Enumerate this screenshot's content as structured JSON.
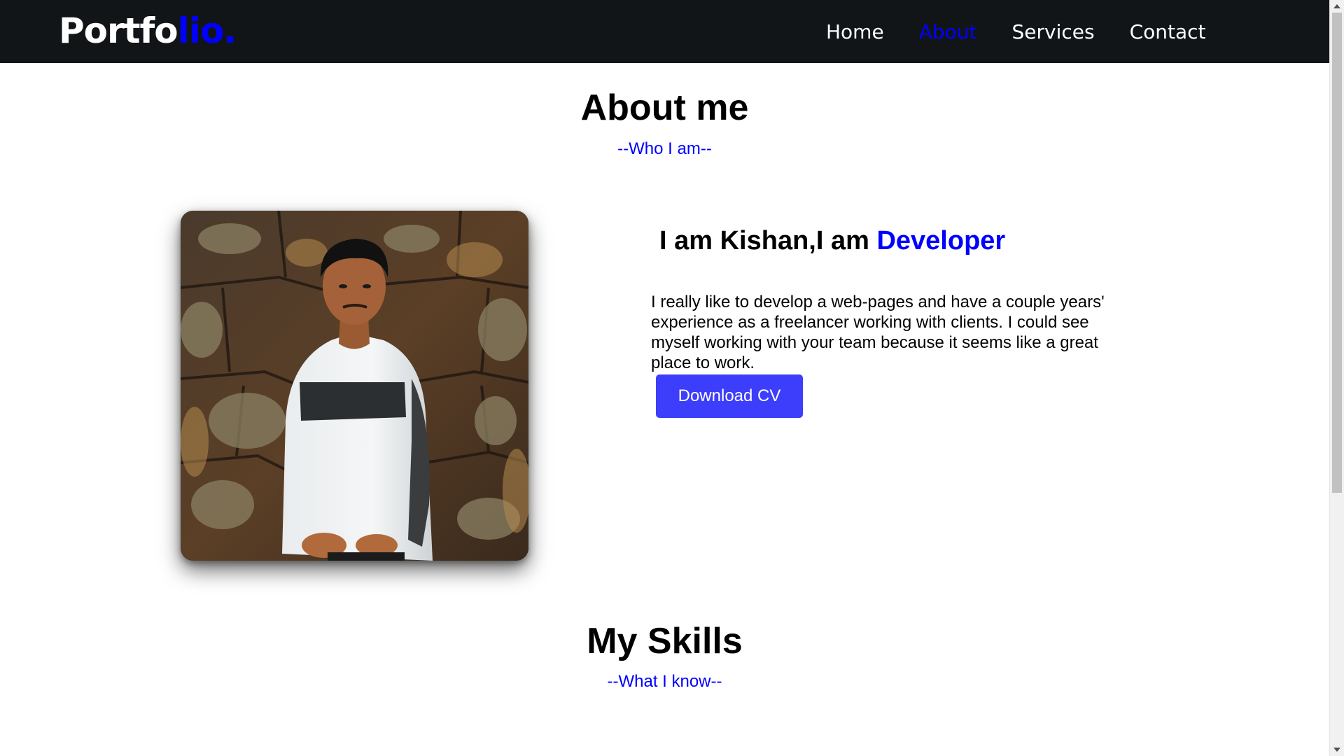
{
  "navbar": {
    "brand_main": "Portfo",
    "brand_accent": "lio.",
    "links": [
      {
        "label": "Home"
      },
      {
        "label": "About"
      },
      {
        "label": "Services"
      },
      {
        "label": "Contact"
      }
    ],
    "active_link": "About"
  },
  "about": {
    "title": "About me",
    "subtitle": "--Who I am--",
    "intro_prefix": "I am Kishan,I am ",
    "intro_role": "Developer",
    "description": "I really like to develop a web-pages and have a couple years' experience as a freelancer working with clients. I could see myself working with your team because it seems like a great place to work.",
    "cv_button": "Download CV"
  },
  "skills": {
    "title": "My Skills",
    "subtitle": "--What I know--"
  },
  "colors": {
    "navbar_bg": "#121517",
    "accent": "#0000ff",
    "button_bg": "#3d3dfc",
    "page_bg": "#ffffff"
  }
}
